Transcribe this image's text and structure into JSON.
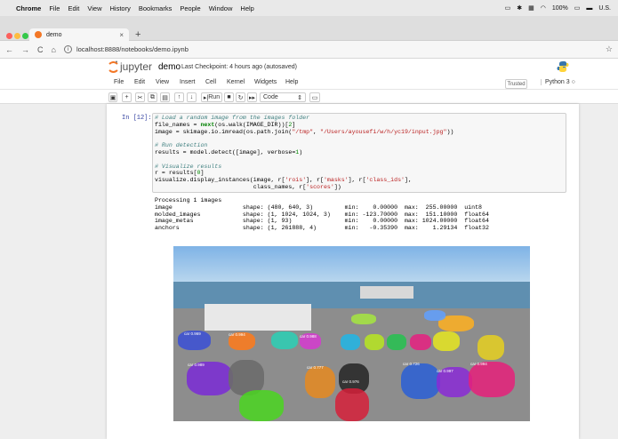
{
  "macmenu": {
    "app": "Chrome",
    "items": [
      "File",
      "Edit",
      "View",
      "History",
      "Bookmarks",
      "People",
      "Window",
      "Help"
    ],
    "battery": "100%",
    "locale": "U.S."
  },
  "browser": {
    "tab_title": "demo",
    "url": "localhost:8888/notebooks/demo.ipynb"
  },
  "jupyter": {
    "logo_text": "jupyter",
    "notebook_name": "demo",
    "checkpoint": "Last Checkpoint: 4 hours ago",
    "autosave": "(autosaved)",
    "menu": [
      "File",
      "Edit",
      "View",
      "Insert",
      "Cell",
      "Kernel",
      "Widgets",
      "Help"
    ],
    "trusted": "Trusted",
    "kernel": "Python 3",
    "toolbar": {
      "run": "Run",
      "cell_type": "Code"
    }
  },
  "cell": {
    "prompt": "In [12]:",
    "code": {
      "l1": "# Load a random image from the images folder",
      "l2a": "file_names = ",
      "l2b": "next",
      "l2c": "(os.walk(IMAGE_DIR))[",
      "l2d": "2",
      "l2e": "]",
      "l3a": "image = skimage.io.imread(os.path.join(",
      "l3b": "\"/tmp\"",
      "l3c": ", ",
      "l3d": "\"/Users/ayousefi/w/h/yc19/input.jpg\"",
      "l3e": "))",
      "l5": "# Run detection",
      "l6a": "results = model.detect([image], verbose=",
      "l6b": "1",
      "l6c": ")",
      "l8": "# Visualize results",
      "l9a": "r = results[",
      "l9b": "0",
      "l9c": "]",
      "l10a": "visualize.display_instances(image, r[",
      "l10b": "'rois'",
      "l10c": "], r[",
      "l10d": "'masks'",
      "l10e": "], r[",
      "l10f": "'class_ids'",
      "l10g": "],",
      "l11a": "                            class_names, r[",
      "l11b": "'scores'",
      "l11c": "])"
    },
    "output": [
      "Processing 1 images",
      "image                    shape: (480, 640, 3)         min:    0.00000  max:  255.00000  uint8",
      "molded_images            shape: (1, 1024, 1024, 3)    min: -123.70000  max:  151.10000  float64",
      "image_metas              shape: (1, 93)               min:    0.00000  max: 1024.00000  float64",
      "anchors                  shape: (1, 261888, 4)        min:   -0.35390  max:    1.29134  float32"
    ],
    "labels": [
      "car 0.969",
      "car 0.994",
      "car 0.989",
      "car 0.777",
      "car 0.726",
      "car 0.997",
      "car 0.994",
      "car 0.976",
      "car 0.988"
    ]
  }
}
